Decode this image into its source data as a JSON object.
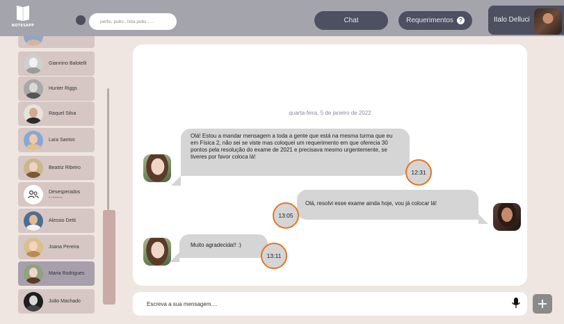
{
  "header": {
    "logo_text": "NOTESAPP",
    "search_placeholder": "perfis, pubs., lista pubs., ...",
    "chat_label": "Chat",
    "requests_label": "Requerimentos",
    "requests_badge": "?",
    "user_name": "Italo Delluci"
  },
  "contacts": [
    {
      "name": "Giannino Balotelli",
      "sub": ""
    },
    {
      "name": "Hunter Riggs",
      "sub": ""
    },
    {
      "name": "Raquel Silva",
      "sub": ""
    },
    {
      "name": "Lara Santos",
      "sub": ""
    },
    {
      "name": "Beatriz Ribeiro",
      "sub": ""
    },
    {
      "name": "Desesperados",
      "sub": "5 membros"
    },
    {
      "name": "Alessio Detti",
      "sub": ""
    },
    {
      "name": "Joana Pereira",
      "sub": ""
    },
    {
      "name": "Maria Rodrigues",
      "sub": ""
    },
    {
      "name": "João Machado",
      "sub": ""
    }
  ],
  "chat": {
    "date": "quarta-feira, 5 de janeiro de 2022",
    "messages": [
      {
        "text": "Olá! Estou a mandar mensagem a toda a gente que está na mesma turma que eu em Física 2, não sei se viste mas coloquei um requerimento em que oferecia 30 pontos pela resolução do exame de 2021 e precisava mesmo urgentemente, se tiveres por favor coloca lá!",
        "time": "12:31"
      },
      {
        "text": "Olá, resolvi esse exame ainda hoje, vou já colocar lá!",
        "time": "13:05"
      },
      {
        "text": "Muito agradecida!! :)",
        "time": "13:11"
      }
    ]
  },
  "composer": {
    "placeholder": "Escreva a sua mensagem...."
  },
  "colors": {
    "topbar": "#a4a4ac",
    "button": "#4d5061",
    "contact": "#d6c7c5",
    "contact_active": "#a79fac",
    "bubble": "#d5d5d5",
    "time_ring": "#e87320",
    "background": "#efe6e1"
  }
}
